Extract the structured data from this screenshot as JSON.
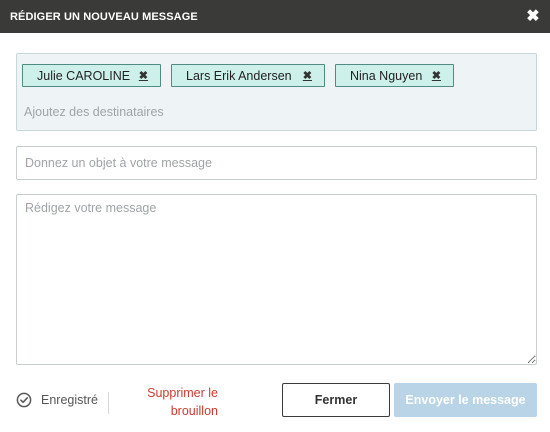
{
  "header": {
    "title": "RÉDIGER UN NOUVEAU MESSAGE",
    "close_icon": "close-icon"
  },
  "recipients": {
    "chips": [
      {
        "name": "Julie CAROLINE",
        "remove_icon": "remove-icon"
      },
      {
        "name": "Lars Erik Andersen",
        "remove_icon": "remove-icon"
      },
      {
        "name": "Nina Nguyen",
        "remove_icon": "remove-icon"
      }
    ],
    "placeholder": "Ajoutez des destinataires",
    "value": ""
  },
  "subject": {
    "placeholder": "Donnez un objet à votre message",
    "value": ""
  },
  "message": {
    "placeholder": "Rédigez votre message",
    "value": ""
  },
  "footer": {
    "saved_label": "Enregistré",
    "saved_icon": "check-circle-icon",
    "delete_draft_label": "Supprimer le brouillon",
    "close_label": "Fermer",
    "send_label": "Envoyer le message"
  },
  "colors": {
    "header_bg": "#3a3a38",
    "chip_bg": "#cdf1ea",
    "chip_border": "#4f8b83",
    "delete_text": "#cc3a2e",
    "send_disabled_bg": "#b9d4e7"
  }
}
